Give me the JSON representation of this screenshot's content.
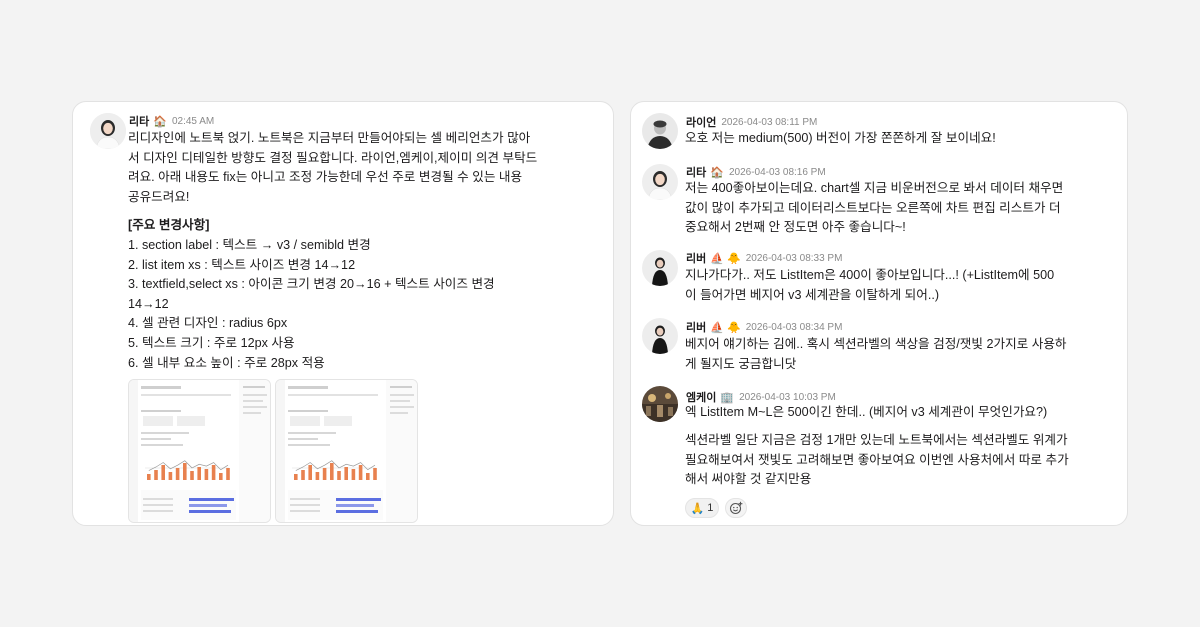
{
  "left": {
    "message": {
      "name": "리타",
      "emoji": "🏠",
      "time": "02:45 AM",
      "body_lines": [
        "리디자인에 노트북 얹기. 노트북은 지금부터 만들어야되는 셀 베리언츠가 많아",
        "서 디자인 디테일한 방향도 결정 필요합니다. 라이언,엠케이,제이미 의견 부탁드",
        "려요. 아래 내용도 fix는 아니고 조정 가능한데 우선 주로 변경될 수 있는 내용",
        "공유드려요!"
      ],
      "changes_title": "[주요 변경사항]",
      "changes": [
        "1. section label : 텍스트 → v3 / semibld 변경",
        "2. list item xs : 텍스트 사이즈 변경 14→12",
        "3. textfield,select xs : 아이콘 크기 변경 20→16 + 텍스트 사이즈 변경",
        "14→12",
        "4. 셀 관련 디자인 : radius 6px",
        "5. 텍스트 크기 : 주로 12px 사용",
        "6. 셀 내부 요소 높이 : 주로 28px 적용"
      ]
    }
  },
  "right": {
    "messages": [
      {
        "name": "라이언",
        "emoji": "",
        "time": "2026-04-03 08:11 PM",
        "lines": [
          "오호 저는 medium(500) 버전이 가장 쫀쫀하게 잘 보이네요!"
        ]
      },
      {
        "name": "리타",
        "emoji": "🏠",
        "time": "2026-04-03 08:16 PM",
        "lines": [
          "저는 400좋아보이는데요. chart셀 지금 비운버전으로 봐서 데이터 채우면",
          "값이 많이 추가되고 데이터리스트보다는 오른쪽에 차트 편집 리스트가 더",
          "중요해서 2번째 안 정도면 아주 좋습니다~!"
        ]
      },
      {
        "name": "리버",
        "emoji": "⛵ 🐥",
        "time": "2026-04-03 08:33 PM",
        "lines": [
          "지나가다가.. 저도 ListItem은 400이 좋아보입니다...! (+ListItem에 500",
          "이 들어가면 베지어 v3 세계관을 이탈하게 되어..)"
        ]
      },
      {
        "name": "리버",
        "emoji": "⛵ 🐥",
        "time": "2026-04-03 08:34 PM",
        "lines": [
          "베지어 얘기하는 김에.. 혹시 섹션라벨의 색상을 검정/잿빛 2가지로 사용하",
          "게 될지도 궁금합니닷"
        ]
      },
      {
        "name": "엠케이",
        "emoji": "🏢",
        "time": "2026-04-03 10:03 PM",
        "lines": [
          "엑 ListItem M~L은 500이긴 한데.. (베지어 v3 세계관이 무엇인가요?)"
        ],
        "followup_lines": [
          "섹션라벨 일단 지금은 검정 1개만 있는데 노트북에서는 섹션라벨도 위계가",
          "필요해보여서 잿빛도 고려해보면 좋아보여요 이번엔 사용처에서 따로 추가",
          "해서 써야할 것 같지만용"
        ]
      }
    ],
    "reaction": {
      "emoji": "🙏",
      "count": "1"
    },
    "add_reaction_icon": "add-reaction-icon"
  },
  "colors": {
    "background": "#f3f3f3",
    "card": "#ffffff",
    "bar_orange": "#e8814f",
    "bar_blue": "#5b6ee1"
  }
}
